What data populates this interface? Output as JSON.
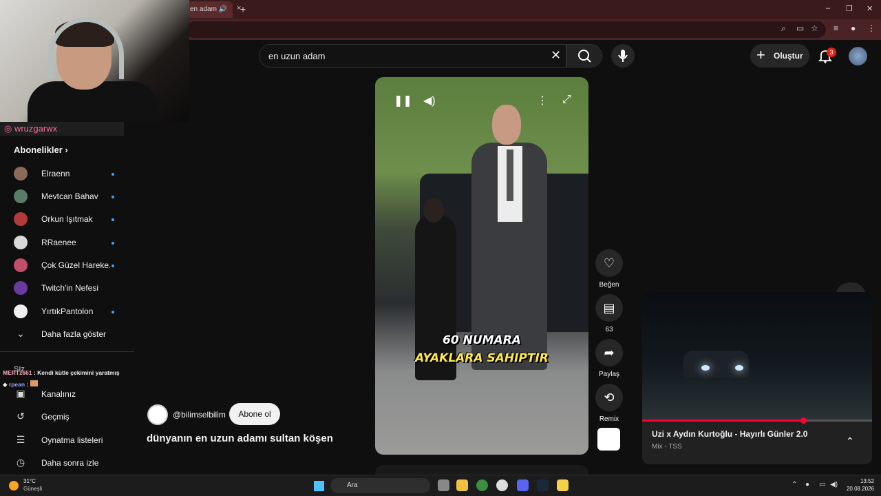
{
  "browser": {
    "tab_title": "en adam",
    "tab_close": "×",
    "new_tab": "+",
    "window_controls": [
      "–",
      "❐",
      "✕"
    ]
  },
  "webcam": {
    "instagram_handle": "wruzgarwx"
  },
  "sidebar": {
    "subscriptions_title": "Abonelikler",
    "channels": [
      {
        "label": "Elraenn",
        "color": "#8a6a5a"
      },
      {
        "label": "Mevtcan Bahav",
        "color": "#5a7a6a"
      },
      {
        "label": "Orkun Işıtmak",
        "color": "#b33a3a"
      },
      {
        "label": "RRaenee",
        "color": "#d9d9d9"
      },
      {
        "label": "Çok Güzel Hareke...",
        "color": "#c0506a"
      },
      {
        "label": "Twitch'in Nefesi",
        "color": "#6a3aa0"
      },
      {
        "label": "YırtıkPantolon",
        "color": "#f0f0f0"
      }
    ],
    "show_more": "Daha fazla göster",
    "you_items": [
      {
        "label": "Kanalınız",
        "icon": "user-icon"
      },
      {
        "label": "Geçmiş",
        "icon": "history-icon"
      },
      {
        "label": "Oynatma listeleri",
        "icon": "playlist-icon"
      },
      {
        "label": "Daha sonra izle",
        "icon": "clock-icon"
      }
    ],
    "you_partial": "Siz",
    "chat_lines": [
      {
        "user": "MERTz661",
        "message": ": Kendi kütle çekimini yaratmış",
        "color": "#f7a8b8"
      },
      {
        "user": "rpean",
        "message": ":",
        "color": "#9aa0ff"
      }
    ]
  },
  "header": {
    "search_value": "en uzun adam",
    "create_label": "Oluştur",
    "notification_count": "3"
  },
  "short": {
    "caption_line1": "60 NUMARA",
    "caption_line2": "AYAKLARA SAHIPTIR",
    "channel_handle": "@bilimselbilim",
    "subscribe_label": "Abone ol",
    "title": "dünyanın en uzun adamı sultan köşen",
    "actions": {
      "like": "Beğen",
      "comments": "63",
      "share": "Paylaş",
      "remix": "Remix"
    }
  },
  "miniplayer": {
    "title": "Uzi x Aydın Kurtoğlu - Hayırlı Günler 2.0",
    "subtitle": "Mix - TSS",
    "progress_fraction": 0.7
  },
  "taskbar": {
    "temperature": "31°C",
    "condition": "Güneşli",
    "search_placeholder": "Ara",
    "time": "13:52",
    "date": "20.08.2026"
  }
}
